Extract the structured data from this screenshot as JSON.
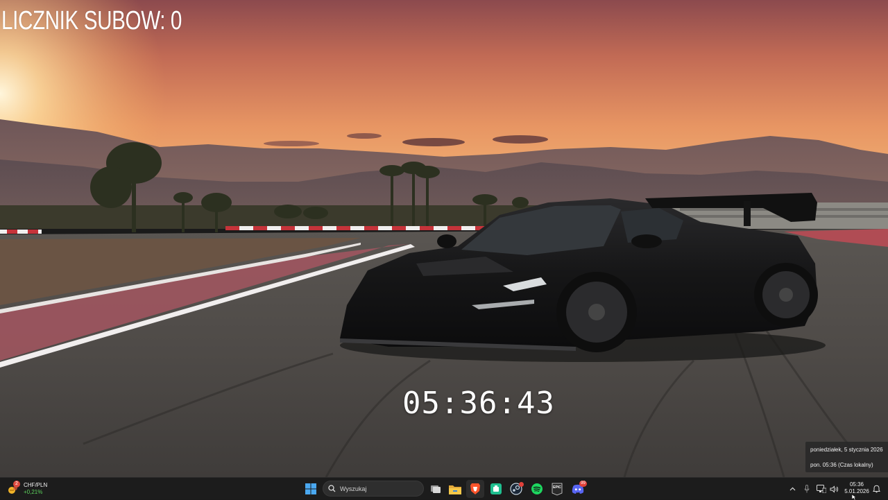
{
  "desktop": {
    "subscriber_counter": "LICZNIK SUBOW: 0",
    "clock": "05:36:43"
  },
  "tooltip": {
    "date_long": "poniedziałek, 5 stycznia 2026",
    "local_time": "pon. 05:36 (Czas lokalny)"
  },
  "taskbar": {
    "widget": {
      "name": "CHF/PLN",
      "change": "+0,21%",
      "badge": "2",
      "change_color": "#5dd35d"
    },
    "search": {
      "placeholder": "Wyszukaj"
    },
    "apps": [
      {
        "name": "start-icon"
      },
      {
        "name": "search-icon"
      },
      {
        "name": "task-view-icon"
      },
      {
        "name": "file-explorer-icon"
      },
      {
        "name": "brave-browser-icon"
      },
      {
        "name": "app-store-icon"
      },
      {
        "name": "steam-icon"
      },
      {
        "name": "spotify-icon"
      },
      {
        "name": "epic-games-icon",
        "label": "EPIC"
      },
      {
        "name": "discord-icon",
        "badge": "99"
      }
    ],
    "tray": {
      "time": "05:36",
      "date": "5.01.2026"
    }
  },
  "colors": {
    "taskbar_bg": "#1c1c1c",
    "accent_blue": "#4aa8f0",
    "spotify_green": "#1ed760",
    "discord_blue": "#5865f2",
    "brave_orange": "#fb542b",
    "badge_red": "#e0413a"
  }
}
